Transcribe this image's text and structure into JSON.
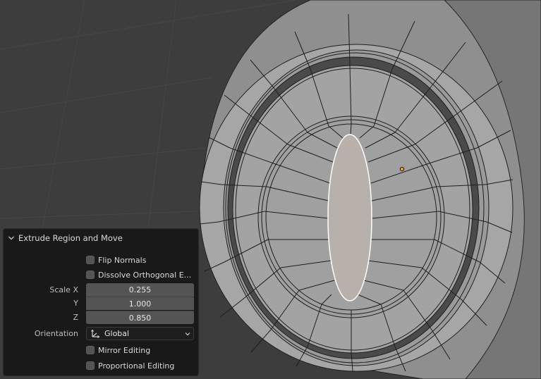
{
  "panel": {
    "title": "Extrude Region and Move",
    "flip_normals": "Flip Normals",
    "dissolve_orthogonal": "Dissolve Orthogonal E...",
    "scale_label": "Scale X",
    "scale_x": "0.255",
    "y_label": "Y",
    "scale_y": "1.000",
    "z_label": "Z",
    "scale_z": "0.850",
    "orientation_label": "Orientation",
    "orientation_value": "Global",
    "mirror_editing": "Mirror Editing",
    "proportional_editing": "Proportional Editing"
  },
  "colors": {
    "viewport_bg": "#3d3d3d",
    "mesh_face": "#9c9c9c",
    "selected_face": "#b8b0aa",
    "selected_edge": "#ffffff",
    "origin_dot": "#ff9a1a"
  }
}
